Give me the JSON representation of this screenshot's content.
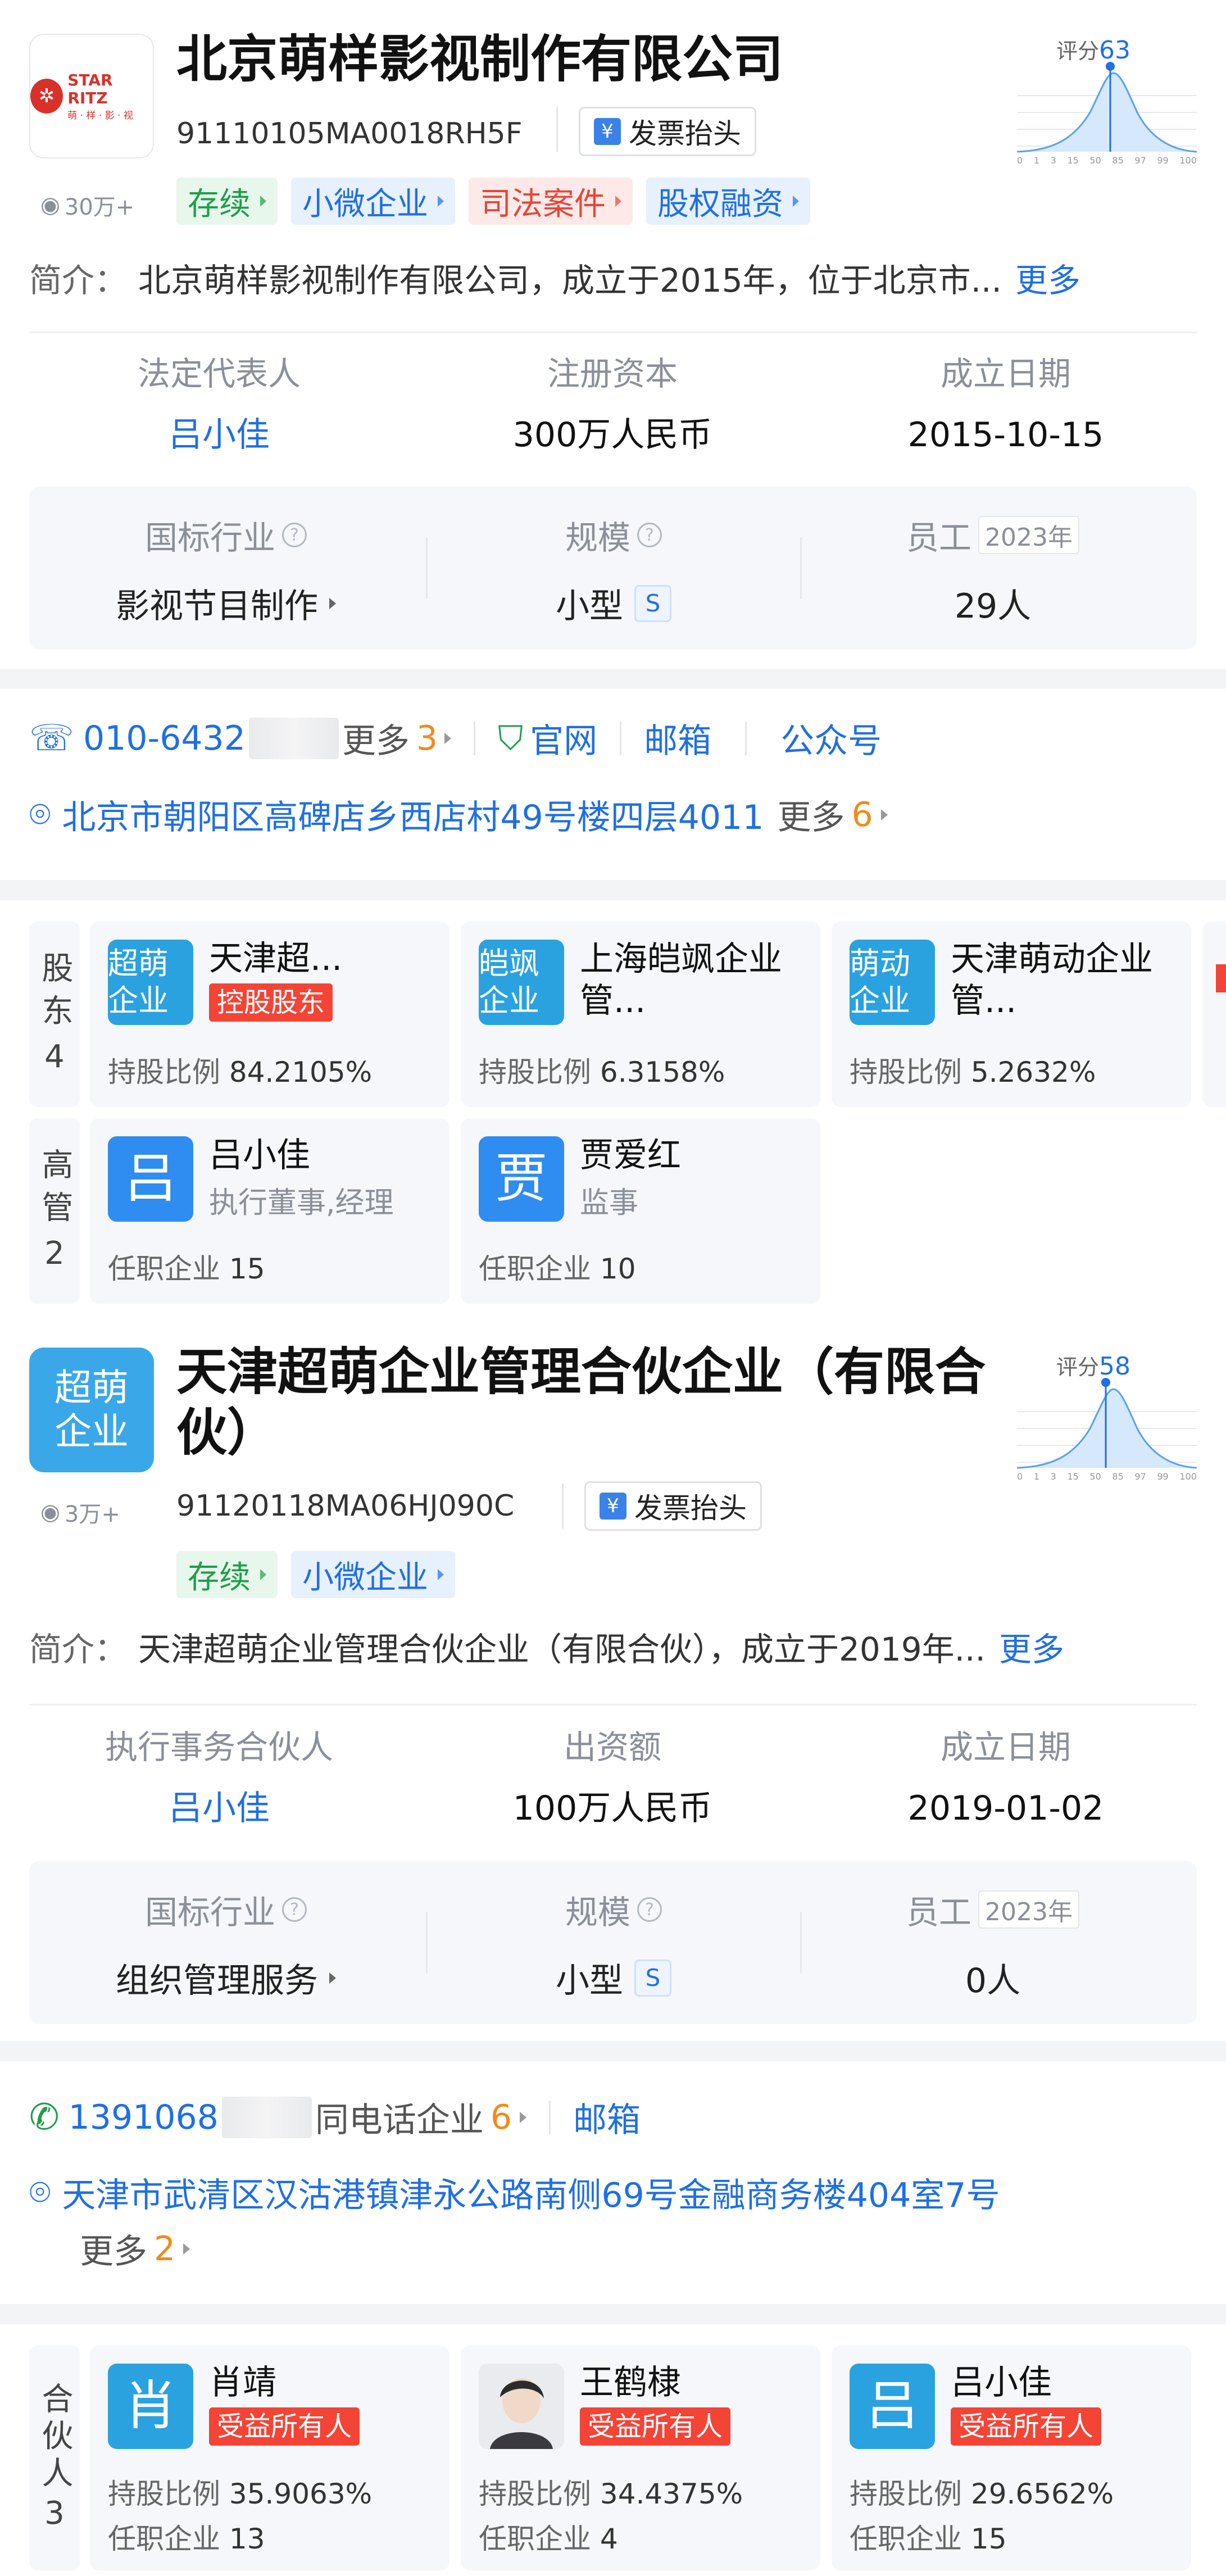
{
  "company1": {
    "logo": {
      "line1": "STAR RITZ",
      "line2": "萌 · 样 · 影 · 视"
    },
    "name": "北京萌样影视制作有限公司",
    "credit_code": "91110105MA0018RH5F",
    "invoice_label": "发票抬头",
    "views": "30万+",
    "score_label": "评分",
    "score": "63",
    "tags": [
      "存续",
      "小微企业",
      "司法案件",
      "股权融资"
    ],
    "intro_label": "简介：",
    "intro": "北京萌样影视制作有限公司，成立于2015年，位于北京市...",
    "more": "更多",
    "legal_rep_label": "法定代表人",
    "legal_rep": "吕小佳",
    "capital_label": "注册资本",
    "capital": "300万人民币",
    "founded_label": "成立日期",
    "founded": "2015-10-15",
    "industry_label": "国标行业",
    "industry": "影视节目制作",
    "scale_label": "规模",
    "scale": "小型",
    "scale_badge": "S",
    "staff_label": "员工",
    "staff_year": "2023年",
    "staff": "29人",
    "phone": "010-6432",
    "phone_more": "更多",
    "phone_more_count": "3",
    "website": "官网",
    "email": "邮箱",
    "wechat": "公众号",
    "address": "北京市朝阳区高碑店乡西店村49号楼四层4011",
    "address_more": "更多",
    "address_more_count": "6",
    "shareholders_label": "股东",
    "shareholders_count": "4",
    "shareholders": [
      {
        "avatar": "超萌企业",
        "name": "天津超...",
        "tag": "控股股东",
        "stat_label": "持股比例",
        "stat": "84.2105%"
      },
      {
        "avatar": "皑飒企业",
        "name": "上海皑飒企业管...",
        "stat_label": "持股比例",
        "stat": "6.3158%"
      },
      {
        "avatar": "萌动企业",
        "name": "天津萌动企业管...",
        "stat_label": "持股比例",
        "stat": "5.2632%"
      }
    ],
    "managers_label": "高管",
    "managers_count": "2",
    "managers": [
      {
        "avatar": "吕",
        "name": "吕小佳",
        "role": "执行董事,经理",
        "stat_label": "任职企业",
        "stat": "15"
      },
      {
        "avatar": "贾",
        "name": "贾爱红",
        "role": "监事",
        "stat_label": "任职企业",
        "stat": "10"
      }
    ]
  },
  "company2": {
    "logo": "超萌企业",
    "name": "天津超萌企业管理合伙企业（有限合伙）",
    "credit_code": "91120118MA06HJ090C",
    "invoice_label": "发票抬头",
    "views": "3万+",
    "score_label": "评分",
    "score": "58",
    "tags": [
      "存续",
      "小微企业"
    ],
    "intro_label": "简介：",
    "intro": "天津超萌企业管理合伙企业（有限合伙），成立于2019年...",
    "more": "更多",
    "partner_label": "执行事务合伙人",
    "partner": "吕小佳",
    "capital_label": "出资额",
    "capital": "100万人民币",
    "founded_label": "成立日期",
    "founded": "2019-01-02",
    "industry_label": "国标行业",
    "industry": "组织管理服务",
    "scale_label": "规模",
    "scale": "小型",
    "scale_badge": "S",
    "staff_label": "员工",
    "staff_year": "2023年",
    "staff": "0人",
    "phone": "1391068",
    "same_phone": "同电话企业",
    "same_phone_count": "6",
    "email": "邮箱",
    "address": "天津市武清区汉沽港镇津永公路南侧69号金融商务楼404室7号",
    "address_more": "更多",
    "address_more_count": "2",
    "partners_label": "合伙人",
    "partners_count": "3",
    "partners": [
      {
        "avatar": "肖",
        "name": "肖靖",
        "tag": "受益所有人",
        "stat1_label": "持股比例",
        "stat1": "35.9063%",
        "stat2_label": "任职企业",
        "stat2": "13"
      },
      {
        "avatar": "photo",
        "name": "王鹤棣",
        "tag": "受益所有人",
        "stat1_label": "持股比例",
        "stat1": "34.4375%",
        "stat2_label": "任职企业",
        "stat2": "4"
      },
      {
        "avatar": "吕",
        "name": "吕小佳",
        "tag": "受益所有人",
        "stat1_label": "持股比例",
        "stat1": "29.6562%",
        "stat2_label": "任职企业",
        "stat2": "15"
      }
    ]
  },
  "chart_ticks": [
    "0",
    "1",
    "3",
    "15",
    "50",
    "85",
    "97",
    "99",
    "100"
  ],
  "colors": {
    "brand_blue": "#1f6fe5",
    "avatar_blue": "#2f8cf0",
    "red_tag": "#f34436",
    "green_tag": "#1e9e4a"
  }
}
